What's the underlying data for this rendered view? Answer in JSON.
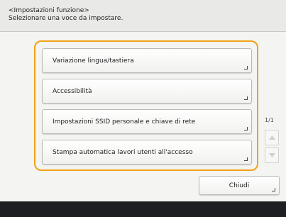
{
  "header": {
    "title": "<Impostazioni funzione>",
    "subtitle": "Selezionare una voce da impostare."
  },
  "menu": {
    "items": [
      {
        "label": "Variazione lingua/tastiera"
      },
      {
        "label": "Accessibilità"
      },
      {
        "label": "Impostazioni SSID personale e chiave di rete"
      },
      {
        "label": "Stampa automatica lavori utenti all'accesso"
      }
    ]
  },
  "pager": {
    "indicator": "1/1",
    "up_icon": "triangle-up-icon",
    "down_icon": "triangle-down-icon"
  },
  "close_button": {
    "label": "Chiudi"
  },
  "colors": {
    "highlight_border": "#f2a114",
    "footer": "#1d1f22"
  }
}
